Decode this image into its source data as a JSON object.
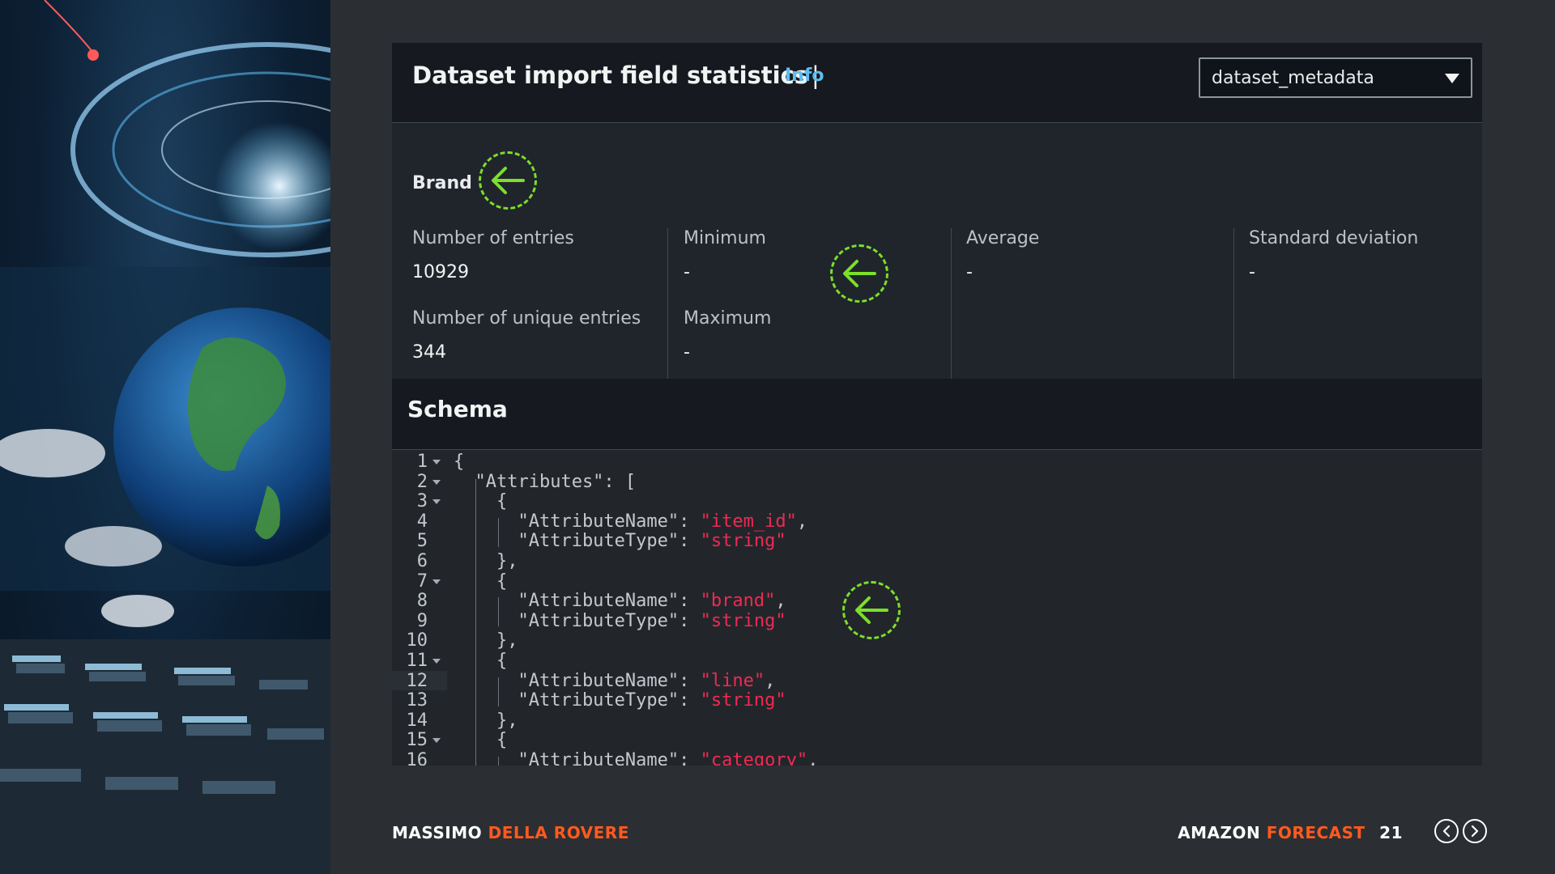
{
  "panel": {
    "title": "Dataset import field statistics",
    "separator": "|",
    "info_link": "Info",
    "dataset_select": {
      "selected": "dataset_metadata"
    }
  },
  "stats": {
    "field_name": "Brand",
    "number_of_entries_label": "Number of entries",
    "number_of_entries_value": "10929",
    "number_of_unique_entries_label": "Number of unique entries",
    "number_of_unique_entries_value": "344",
    "minimum_label": "Minimum",
    "minimum_value": "-",
    "maximum_label": "Maximum",
    "maximum_value": "-",
    "average_label": "Average",
    "average_value": "-",
    "std_dev_label": "Standard deviation",
    "std_dev_value": "-"
  },
  "schema": {
    "title": "Schema",
    "lines": [
      {
        "n": "1",
        "text": "{",
        "fold": true
      },
      {
        "n": "2",
        "text": "  \"Attributes\": [",
        "fold": true
      },
      {
        "n": "3",
        "text": "    {",
        "fold": true
      },
      {
        "n": "4",
        "key": "      \"AttributeName\": ",
        "str": "\"item_id\"",
        "tail": ","
      },
      {
        "n": "5",
        "key": "      \"AttributeType\": ",
        "str": "\"string\"",
        "tail": ""
      },
      {
        "n": "6",
        "text": "    },"
      },
      {
        "n": "7",
        "text": "    {",
        "fold": true
      },
      {
        "n": "8",
        "key": "      \"AttributeName\": ",
        "str": "\"brand\"",
        "tail": ","
      },
      {
        "n": "9",
        "key": "      \"AttributeType\": ",
        "str": "\"string\"",
        "tail": ""
      },
      {
        "n": "10",
        "text": "    },"
      },
      {
        "n": "11",
        "text": "    {",
        "fold": true
      },
      {
        "n": "12",
        "key": "      \"AttributeName\": ",
        "str": "\"line\"",
        "tail": ",",
        "active": true
      },
      {
        "n": "13",
        "key": "      \"AttributeType\": ",
        "str": "\"string\"",
        "tail": ""
      },
      {
        "n": "14",
        "text": "    },"
      },
      {
        "n": "15",
        "text": "    {",
        "fold": true
      },
      {
        "n": "16",
        "key": "      \"AttributeName\": ",
        "str": "\"category\"",
        "tail": ","
      }
    ]
  },
  "footer": {
    "author_first": "MASSIMO",
    "author_last": "DELLA ROVERE",
    "product_first": "AMAZON",
    "product_second": "FORECAST",
    "page_number": "21"
  },
  "colors": {
    "accent_orange": "#ff5a1f",
    "marker_green": "#7cdf2a",
    "info_blue": "#5dbdf1",
    "string_red": "#ef2a52"
  },
  "icons": [
    "left-arrow-icon",
    "chevron-left-icon",
    "chevron-right-icon",
    "caret-down-icon"
  ]
}
